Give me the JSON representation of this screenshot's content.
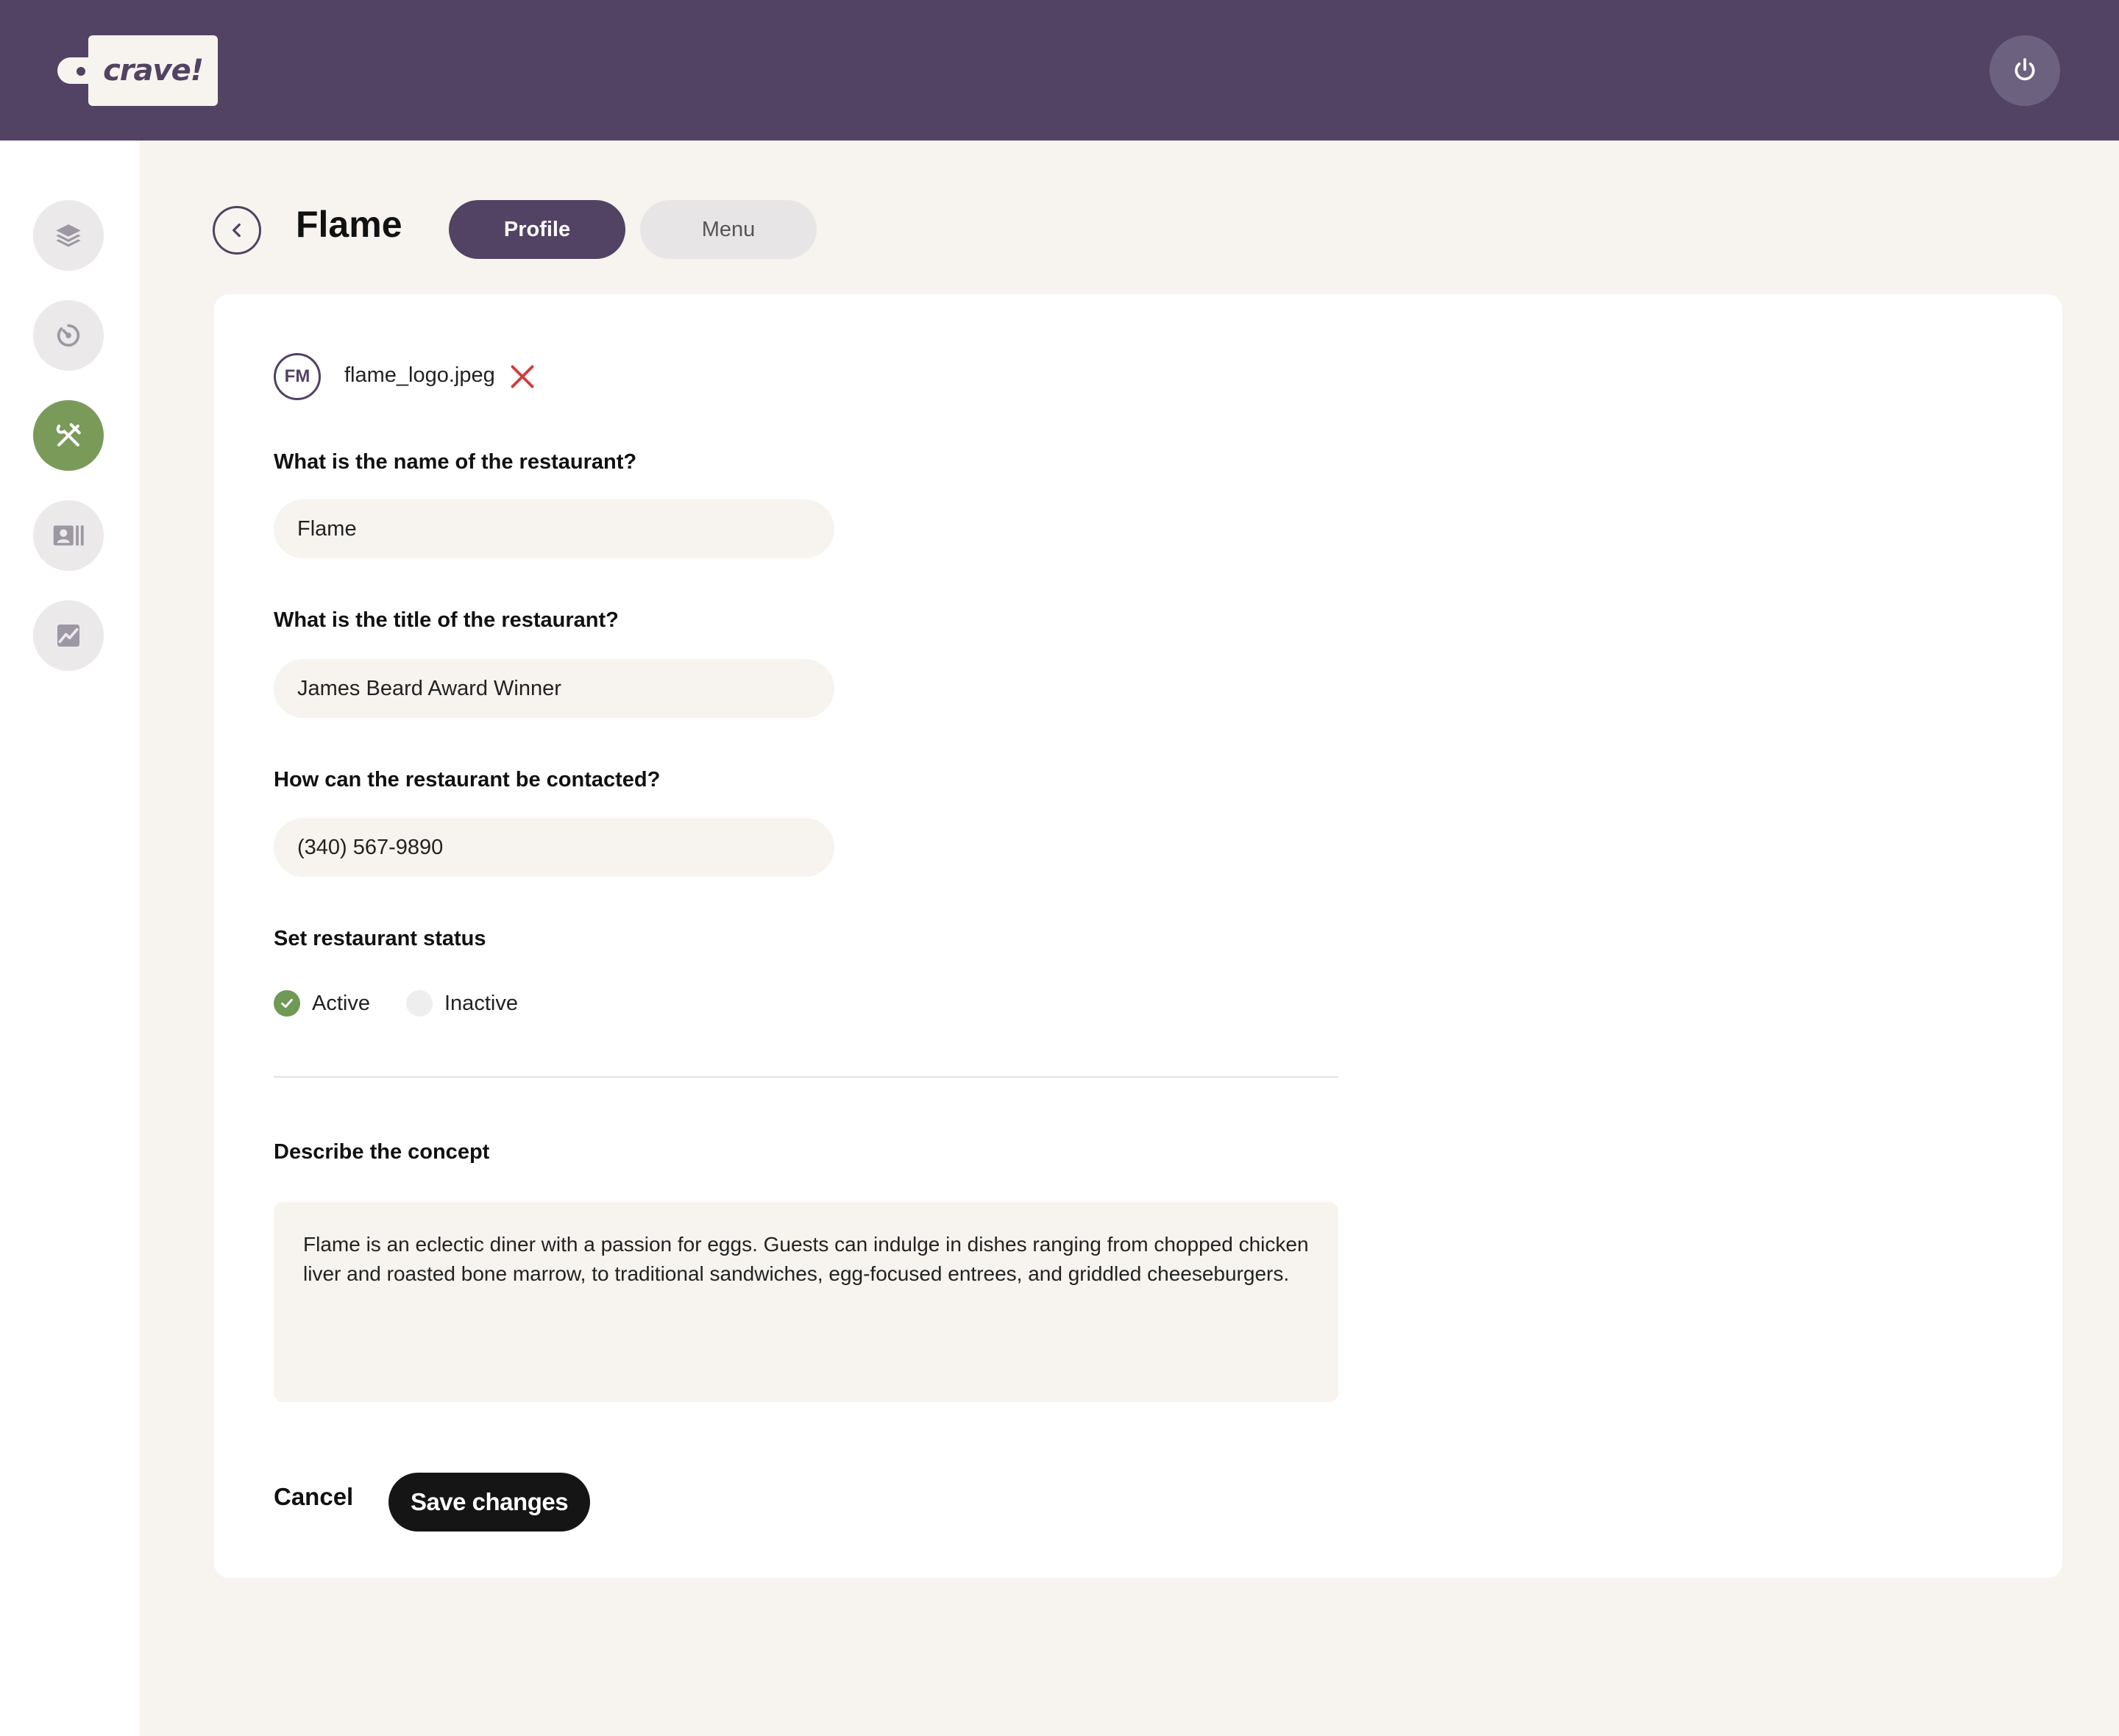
{
  "app": {
    "logo_text": "crave!",
    "brand_color": "#524263",
    "accent_color": "#7a9a5a"
  },
  "header": {
    "power_icon": "power-icon"
  },
  "sidebar": {
    "items": [
      {
        "icon": "layers-icon",
        "active": false
      },
      {
        "icon": "timer-icon",
        "active": false
      },
      {
        "icon": "utensils-icon",
        "active": true
      },
      {
        "icon": "contact-card-icon",
        "active": false
      },
      {
        "icon": "analytics-image-icon",
        "active": false
      }
    ]
  },
  "page": {
    "title": "Flame",
    "tabs": [
      {
        "label": "Profile",
        "selected": true
      },
      {
        "label": "Menu",
        "selected": false
      }
    ]
  },
  "form": {
    "logo_initials": "FM",
    "logo_file": "flame_logo.jpeg",
    "name_label": "What is the name of the restaurant?",
    "name_value": "Flame",
    "title_label": "What is the title of the restaurant?",
    "title_value": "James Beard Award Winner",
    "contact_label": "How can the restaurant be contacted?",
    "contact_value": "(340) 567-9890",
    "status_label": "Set restaurant status",
    "status_options": [
      {
        "label": "Active",
        "checked": true
      },
      {
        "label": "Inactive",
        "checked": false
      }
    ],
    "concept_label": "Describe the concept",
    "concept_value": "Flame is an eclectic diner with a passion for eggs. Guests can indulge in dishes ranging from chopped chicken liver and roasted bone marrow, to traditional sandwiches, egg-focused entrees, and griddled cheeseburgers.",
    "cancel_label": "Cancel",
    "save_label": "Save changes"
  }
}
